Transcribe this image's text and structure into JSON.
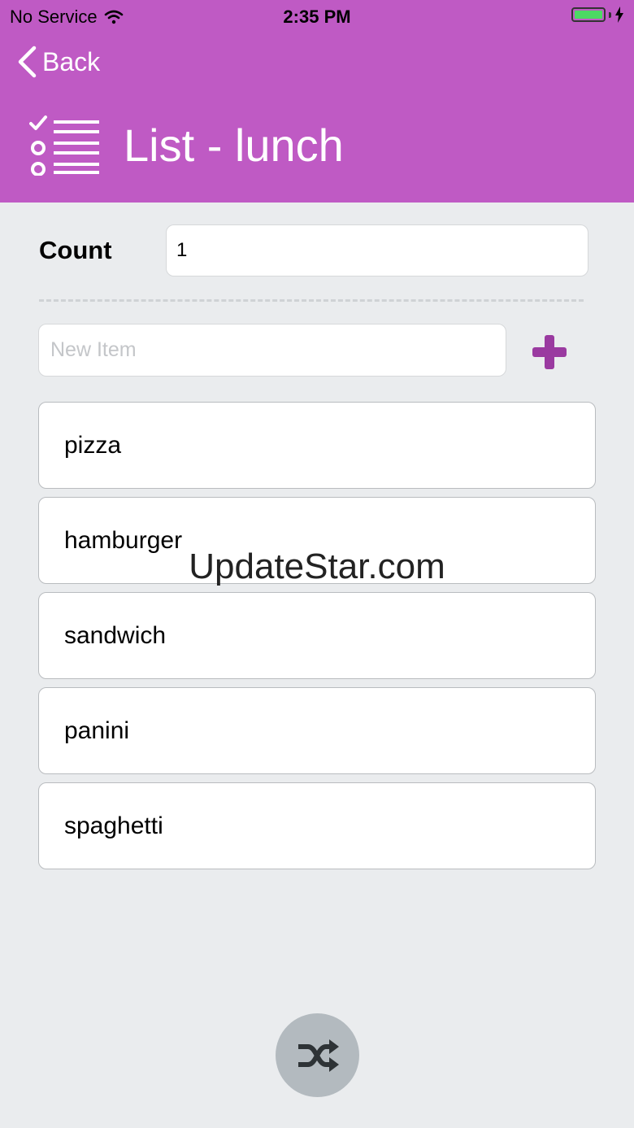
{
  "status_bar": {
    "carrier": "No Service",
    "time": "2:35 PM"
  },
  "nav": {
    "back_label": "Back"
  },
  "header": {
    "title": "List - lunch",
    "icon": "checklist-icon",
    "color": "#bf5ac4"
  },
  "count": {
    "label": "Count",
    "value": "1"
  },
  "new_item": {
    "placeholder": "New Item",
    "value": ""
  },
  "items": [
    {
      "label": "pizza"
    },
    {
      "label": "hamburger"
    },
    {
      "label": "sandwich"
    },
    {
      "label": "panini"
    },
    {
      "label": "spaghetti"
    }
  ],
  "watermark": "UpdateStar.com",
  "colors": {
    "accent": "#9a3aa0",
    "background": "#eaecee",
    "shuffle_button": "#b3babf"
  },
  "icons": {
    "add": "plus-icon",
    "shuffle": "shuffle-icon"
  }
}
